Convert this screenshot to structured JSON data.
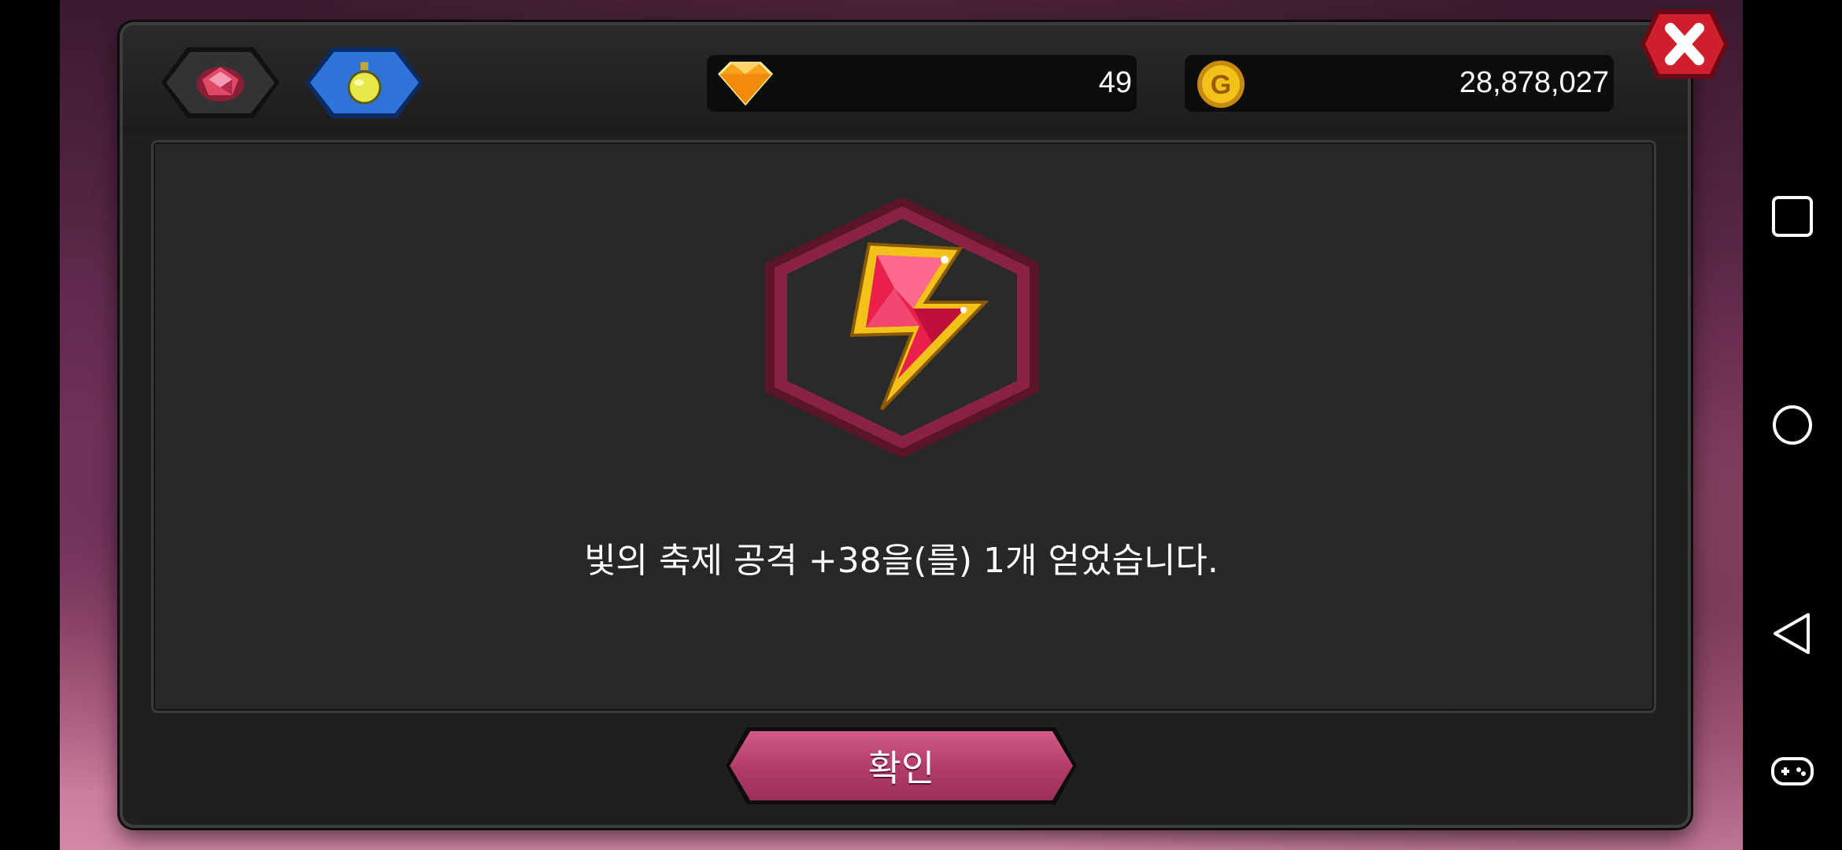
{
  "currency": {
    "diamonds": "49",
    "gold": "28,878,027"
  },
  "tabs": [
    {
      "icon": "ruby-gem-icon"
    },
    {
      "icon": "potion-flask-icon"
    }
  ],
  "dialog": {
    "item_icon": "lightning-gem-emblem-icon",
    "message": "빛의 축제 공격 +38을(를) 1개 얻었습니다.",
    "confirm_label": "확인"
  },
  "close_icon": "close-icon",
  "colors": {
    "confirm_button": "#b13b68",
    "close_button": "#d01f2c",
    "active_tab": "#2f74d8",
    "emblem_border": "#8a2343",
    "gem": "#e8204a",
    "gold": "#f2c21a"
  },
  "android_nav": [
    {
      "icon": "recent-apps-icon"
    },
    {
      "icon": "home-icon"
    },
    {
      "icon": "back-icon"
    },
    {
      "icon": "game-controller-icon"
    }
  ]
}
